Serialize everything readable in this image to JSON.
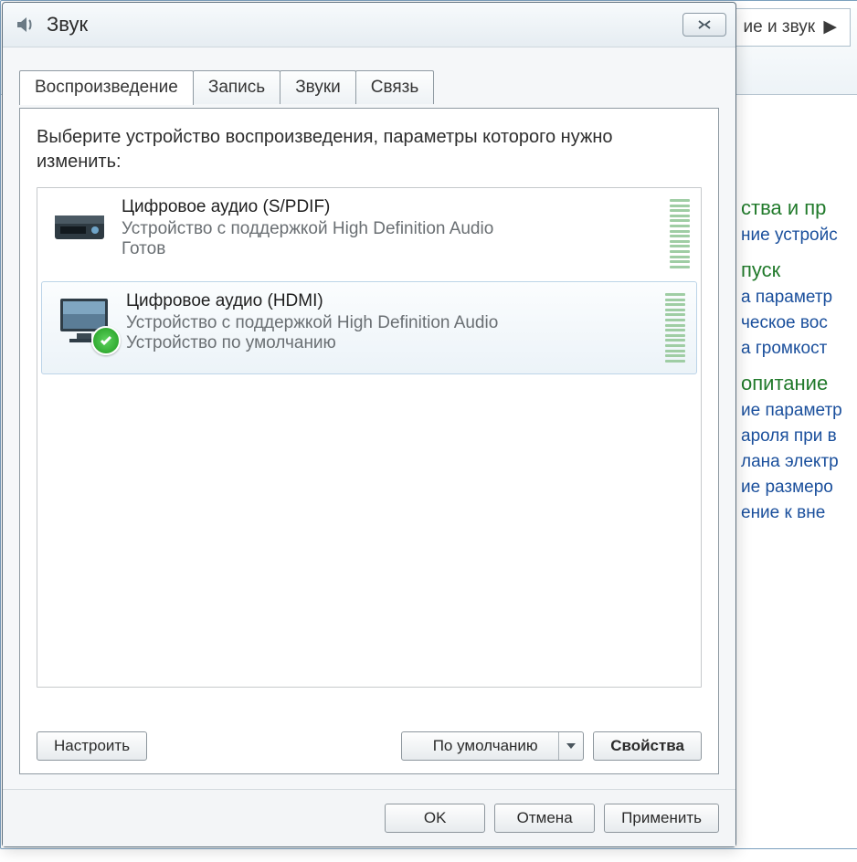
{
  "bg": {
    "breadcrumb": "ие и звук",
    "sections": [
      {
        "title": "ства и пр",
        "links": [
          "ние устройс"
        ]
      },
      {
        "title": "пуск",
        "links": [
          "а параметр",
          "ческое вос"
        ]
      },
      {
        "title": "",
        "links": [
          "а громкост"
        ]
      },
      {
        "title": "опитание",
        "links": [
          "ие параметр",
          "ароля при в",
          "лана электр"
        ]
      },
      {
        "title": "",
        "links": [
          "ие размеро",
          "ение к вне"
        ]
      }
    ]
  },
  "dialog": {
    "title": "Звук",
    "tabs": [
      "Воспроизведение",
      "Запись",
      "Звуки",
      "Связь"
    ],
    "activeTab": 0,
    "instruction": "Выберите устройство воспроизведения, параметры которого нужно изменить:",
    "devices": [
      {
        "name": "Цифровое аудио (S/PDIF)",
        "desc": "Устройство с поддержкой High Definition Audio",
        "status": "Готов",
        "default": false,
        "selected": false,
        "icon": "amp"
      },
      {
        "name": "Цифровое аудио (HDMI)",
        "desc": "Устройство с поддержкой High Definition Audio",
        "status": "Устройство по умолчанию",
        "default": true,
        "selected": true,
        "icon": "monitor"
      }
    ],
    "buttons": {
      "configure": "Настроить",
      "setDefault": "По умолчанию",
      "properties": "Свойства",
      "ok": "OK",
      "cancel": "Отмена",
      "apply": "Применить"
    }
  }
}
